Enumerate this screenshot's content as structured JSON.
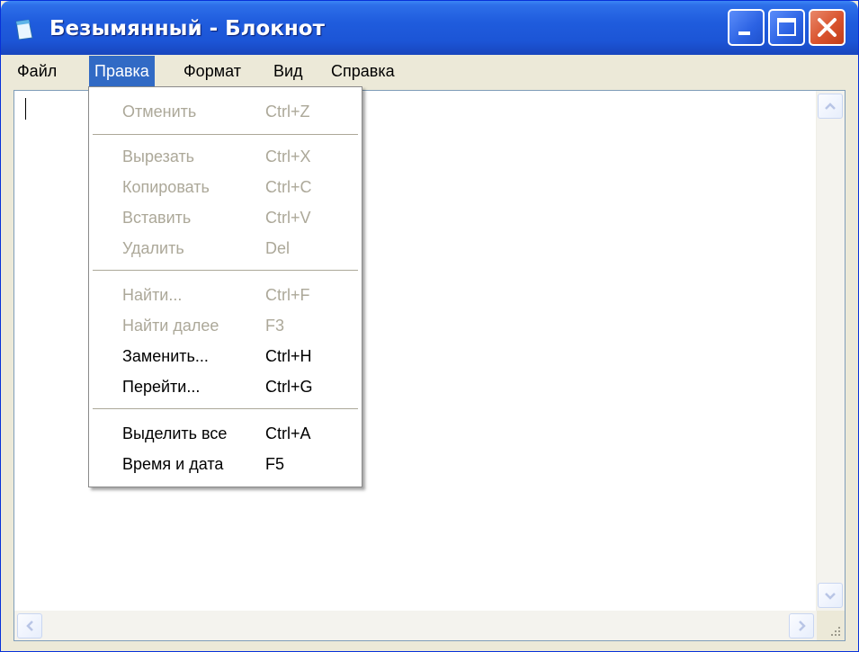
{
  "window": {
    "title": "Безымянный - Блокнот"
  },
  "menubar": {
    "items": [
      {
        "label": "Файл"
      },
      {
        "label": "Правка"
      },
      {
        "label": "Формат"
      },
      {
        "label": "Вид"
      },
      {
        "label": "Справка"
      }
    ],
    "active": "Правка"
  },
  "edit_menu": {
    "items": [
      {
        "label": "Отменить",
        "shortcut": "Ctrl+Z",
        "enabled": false
      },
      {
        "label": "Вырезать",
        "shortcut": "Ctrl+X",
        "enabled": false
      },
      {
        "label": "Копировать",
        "shortcut": "Ctrl+C",
        "enabled": false
      },
      {
        "label": "Вставить",
        "shortcut": "Ctrl+V",
        "enabled": false
      },
      {
        "label": "Удалить",
        "shortcut": "Del",
        "enabled": false
      },
      {
        "label": "Найти...",
        "shortcut": "Ctrl+F",
        "enabled": false
      },
      {
        "label": "Найти далее",
        "shortcut": "F3",
        "enabled": false
      },
      {
        "label": "Заменить...",
        "shortcut": "Ctrl+H",
        "enabled": true
      },
      {
        "label": "Перейти...",
        "shortcut": "Ctrl+G",
        "enabled": true
      },
      {
        "label": "Выделить все",
        "shortcut": "Ctrl+A",
        "enabled": true
      },
      {
        "label": "Время и дата",
        "shortcut": "F5",
        "enabled": true
      }
    ]
  },
  "editor": {
    "content": ""
  },
  "colors": {
    "titlebar": "#1f5cdd",
    "menu_highlight": "#316ac5",
    "disabled_text": "#aca899",
    "close_button": "#d9532e"
  },
  "icons": {
    "app": "notepad-icon",
    "minimize": "minimize-icon",
    "maximize": "maximize-icon",
    "close": "close-icon",
    "scroll_up": "scroll-up-arrow-icon",
    "scroll_down": "scroll-down-arrow-icon",
    "scroll_left": "scroll-left-arrow-icon",
    "scroll_right": "scroll-right-arrow-icon",
    "grip": "resize-grip-icon"
  }
}
